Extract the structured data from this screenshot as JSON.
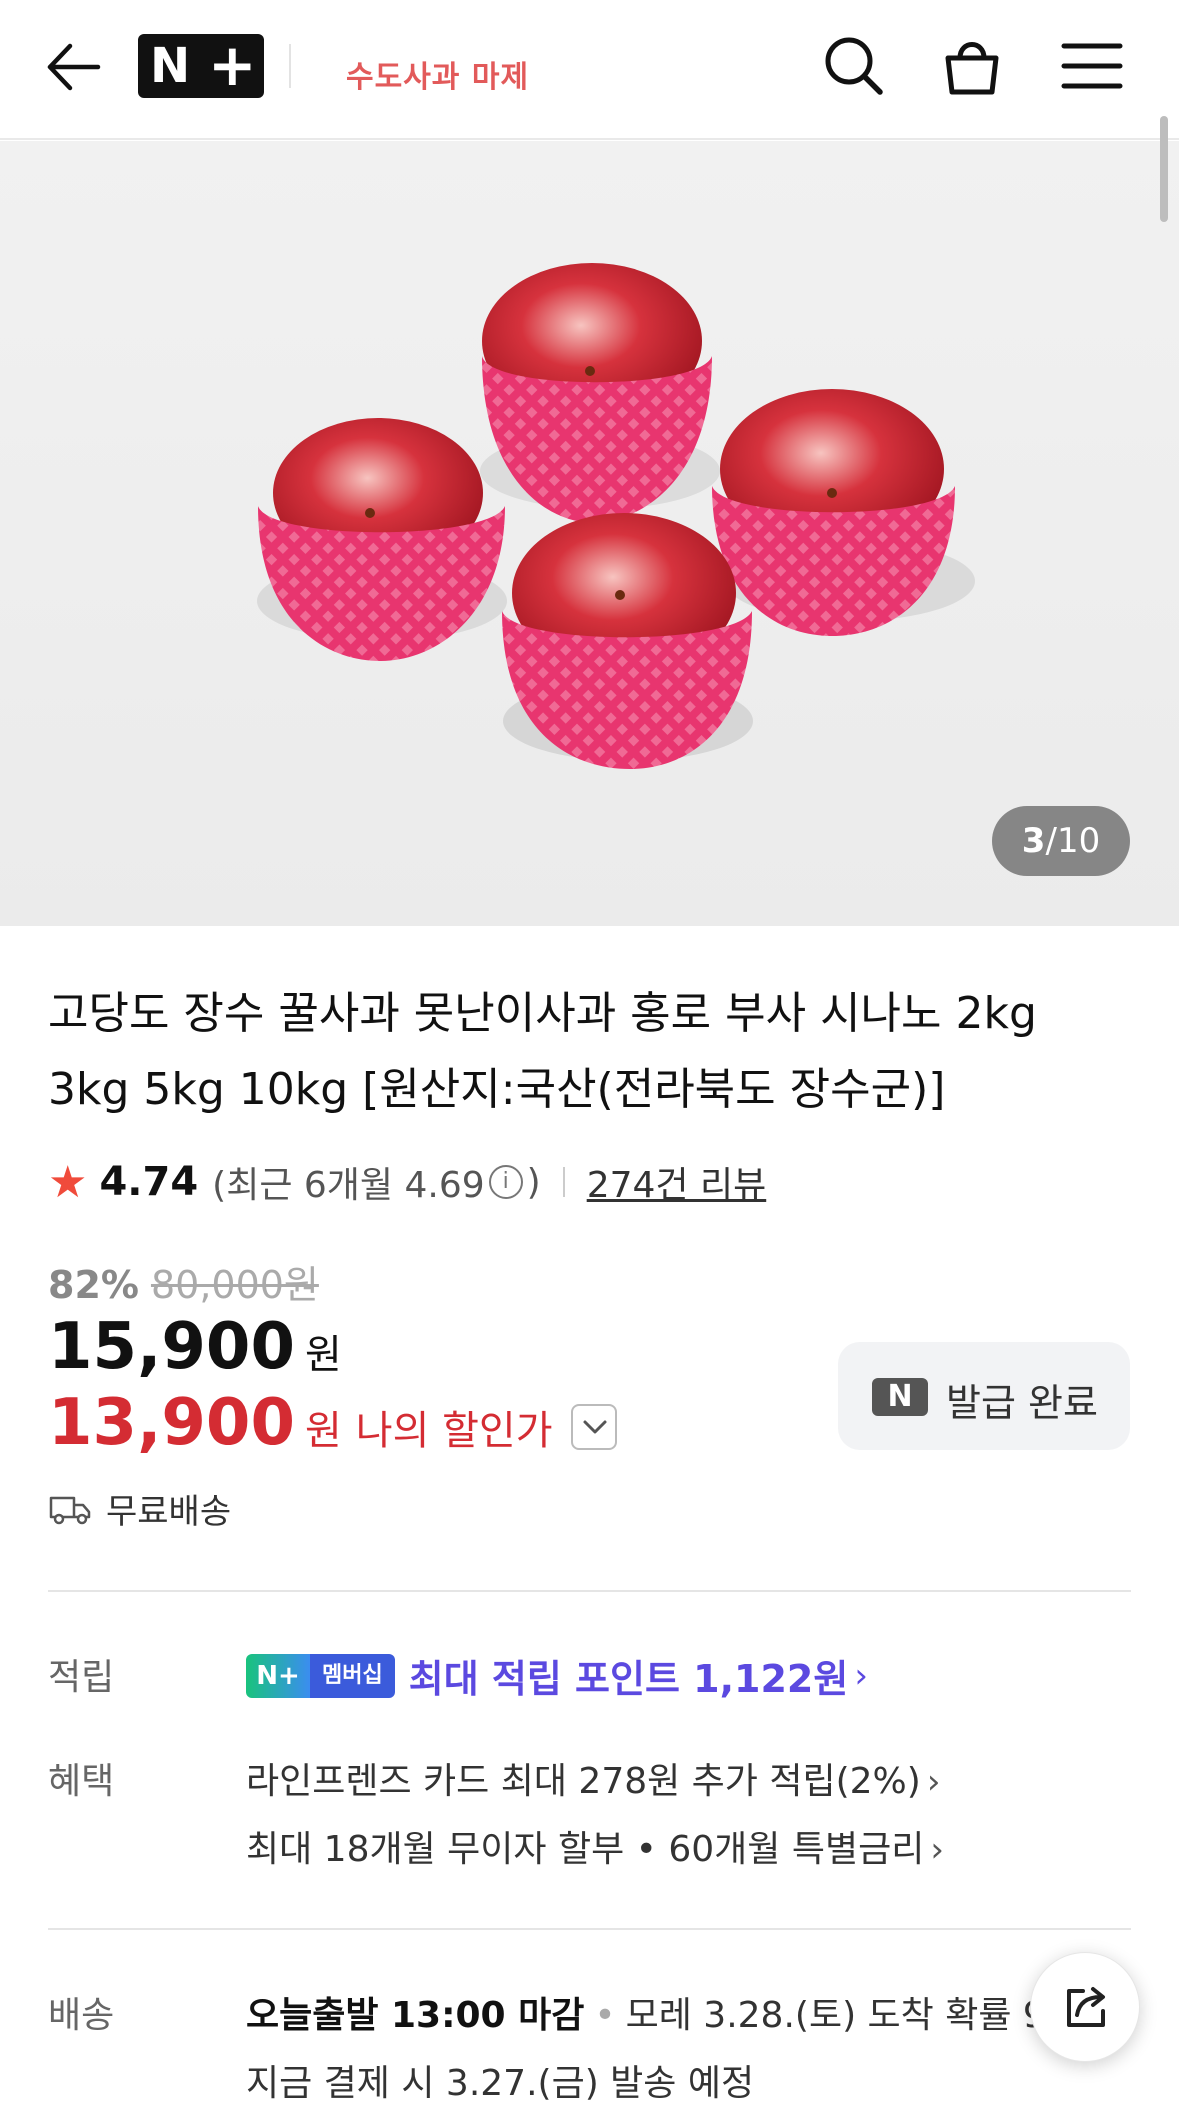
{
  "header": {
    "brand_letter": "N",
    "brand_plus": "+",
    "store_name": "수도사과 마제"
  },
  "gallery": {
    "current": "3",
    "total": "10",
    "separator": "/"
  },
  "product": {
    "title": "고당도 장수 꿀사과 못난이사과 홍로 부사 시나노 2kg 3kg 5kg 10kg [원산지:국산(전라북도 장수군)]"
  },
  "rating": {
    "score": "4.74",
    "recent_label": "(최근 6개월 4.69",
    "recent_close": ")",
    "info_glyph": "i",
    "review_count": "274건 리뷰"
  },
  "price": {
    "discount_rate": "82%",
    "original_price": "80,000원",
    "sale_price": "15,900",
    "currency": "원",
    "my_discount_price": "13,900",
    "my_discount_currency": "원",
    "my_discount_label": "나의 할인가"
  },
  "coupon": {
    "icon_letter": "N",
    "label": "발급 완료"
  },
  "shipping": {
    "label": "무료배송"
  },
  "points": {
    "label": "적립",
    "badge_n": "N+",
    "badge_membership": "멤버십",
    "text": "최대 적립 포인트 1,122원",
    "chevron": "›"
  },
  "benefits": {
    "label": "혜택",
    "line1": "라인프렌즈 카드 최대 278원 추가 적립(2%)",
    "line2": "최대 18개월 무이자 할부 • 60개월 특별금리",
    "chevron": "›"
  },
  "delivery": {
    "label": "배송",
    "cutoff": "오늘출발 13:00 마감",
    "dot": "•",
    "arrival": "모레 3.28.(토) 도착 확률 9",
    "ship_notice": "지금 결제 시 3.27.(금) 발송 예정"
  },
  "colors": {
    "accent_red": "#d42c33",
    "points_purple": "#5b49e0",
    "star": "#f04b3b"
  },
  "icons": [
    "back-arrow-icon",
    "search-icon",
    "shopping-bag-icon",
    "menu-icon",
    "info-icon",
    "truck-icon",
    "chevron-down-icon",
    "share-icon"
  ]
}
